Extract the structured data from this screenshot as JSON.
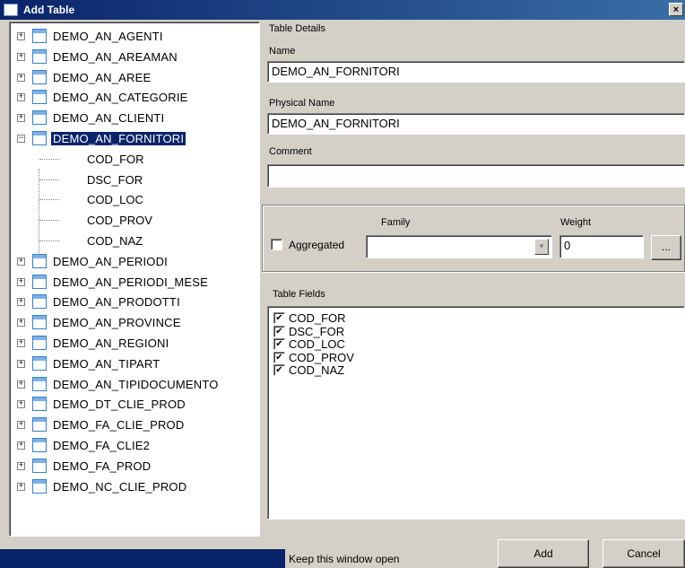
{
  "window": {
    "title": "Add Table",
    "close_glyph": "×"
  },
  "tree": {
    "items_before": [
      "DEMO_AN_AGENTI",
      "DEMO_AN_AREAMAN",
      "DEMO_AN_AREE",
      "DEMO_AN_CATEGORIE",
      "DEMO_AN_CLIENTI"
    ],
    "selected": "DEMO_AN_FORNITORI",
    "children": [
      "COD_FOR",
      "DSC_FOR",
      "COD_LOC",
      "COD_PROV",
      "COD_NAZ"
    ],
    "items_after": [
      "DEMO_AN_PERIODI",
      "DEMO_AN_PERIODI_MESE",
      "DEMO_AN_PRODOTTI",
      "DEMO_AN_PROVINCE",
      "DEMO_AN_REGIONI",
      "DEMO_AN_TIPART",
      "DEMO_AN_TIPIDOCUMENTO",
      "DEMO_DT_CLIE_PROD",
      "DEMO_FA_CLIE_PROD",
      "DEMO_FA_CLIE2",
      "DEMO_FA_PROD",
      "DEMO_NC_CLIE_PROD"
    ],
    "expand_glyph": "+",
    "collapse_glyph": "−"
  },
  "details": {
    "group_label": "Table Details",
    "name_label": "Name",
    "name_value": "DEMO_AN_FORNITORI",
    "physical_label": "Physical Name",
    "physical_value": "DEMO_AN_FORNITORI",
    "comment_label": "Comment",
    "comment_value": ""
  },
  "aggregation": {
    "aggregated_label": "Aggregated",
    "aggregated_checked": false,
    "family_label": "Family",
    "family_value": "",
    "weight_label": "Weight",
    "weight_value": "0",
    "browse_label": "..."
  },
  "fields": {
    "label": "Table Fields",
    "items": [
      {
        "name": "COD_FOR",
        "checked": true
      },
      {
        "name": "DSC_FOR",
        "checked": true
      },
      {
        "name": "COD_LOC",
        "checked": true
      },
      {
        "name": "COD_PROV",
        "checked": true
      },
      {
        "name": "COD_NAZ",
        "checked": true
      }
    ],
    "check_glyph": "✔"
  },
  "footer": {
    "keep_open_label": "Keep this window open",
    "add_label": "Add",
    "cancel_label": "Cancel"
  }
}
